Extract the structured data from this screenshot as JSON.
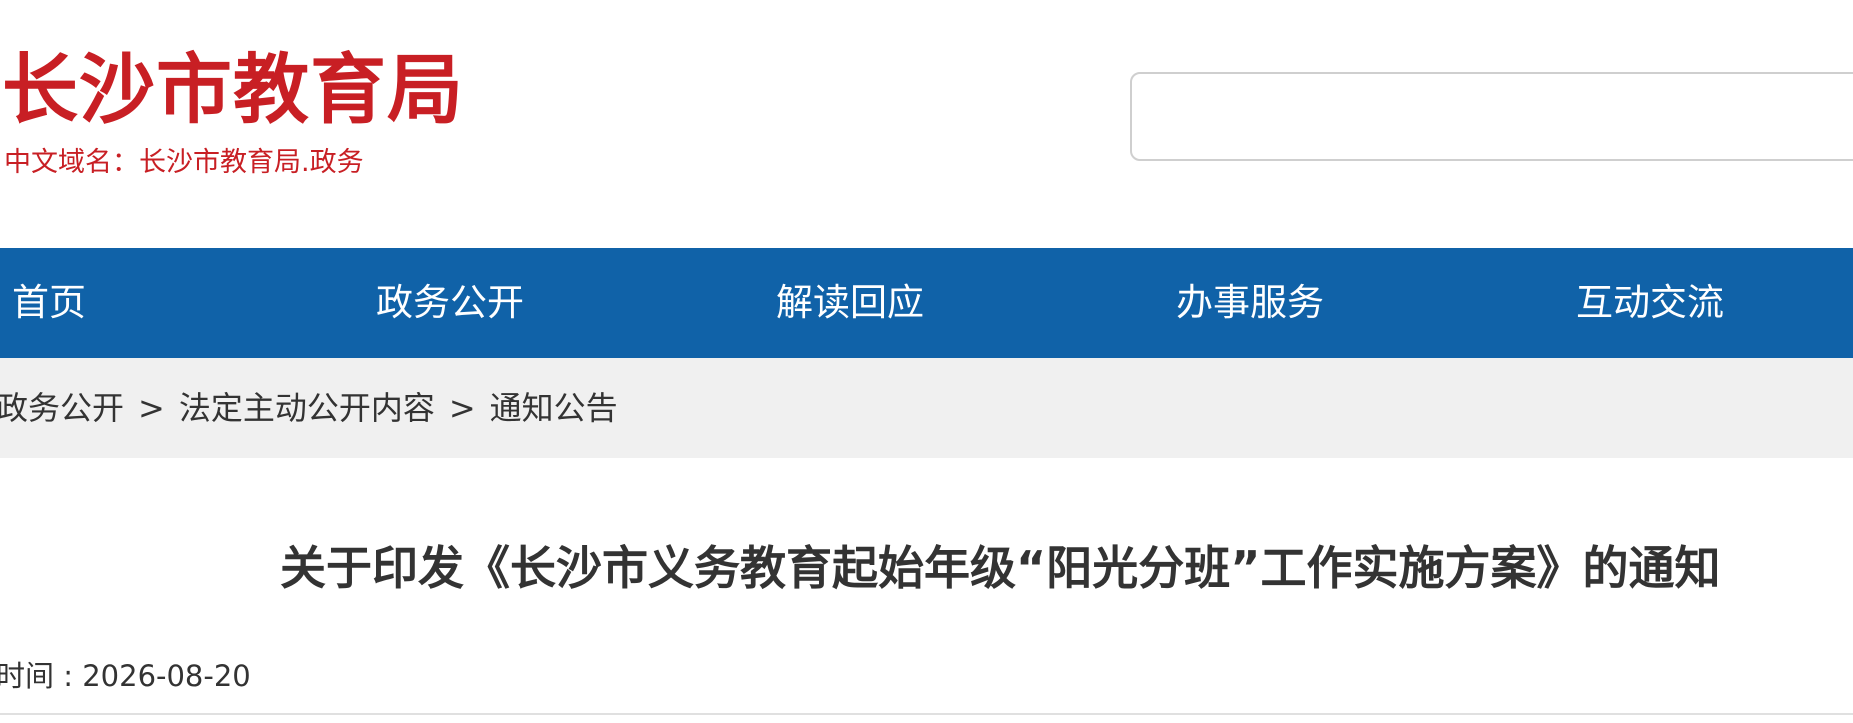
{
  "header": {
    "site_title": "长沙市教育局",
    "domain_text": "中文域名：长沙市教育局.政务",
    "search": {
      "value": "",
      "placeholder": ""
    }
  },
  "nav": {
    "items": [
      {
        "label": "首页"
      },
      {
        "label": "政务公开"
      },
      {
        "label": "解读回应"
      },
      {
        "label": "办事服务"
      },
      {
        "label": "互动交流"
      }
    ]
  },
  "breadcrumb": {
    "items": [
      "政务公开",
      "法定主动公开内容",
      "通知公告"
    ],
    "separator": ">"
  },
  "article": {
    "title": "关于印发《长沙市义务教育起始年级“阳光分班”工作实施方案》的通知",
    "publish_label": "时间 : ",
    "publish_date": "2026-08-20"
  },
  "colors": {
    "brand_red": "#c81f24",
    "nav_blue": "#1062a8",
    "breadcrumb_bg": "#f0f0f0"
  }
}
